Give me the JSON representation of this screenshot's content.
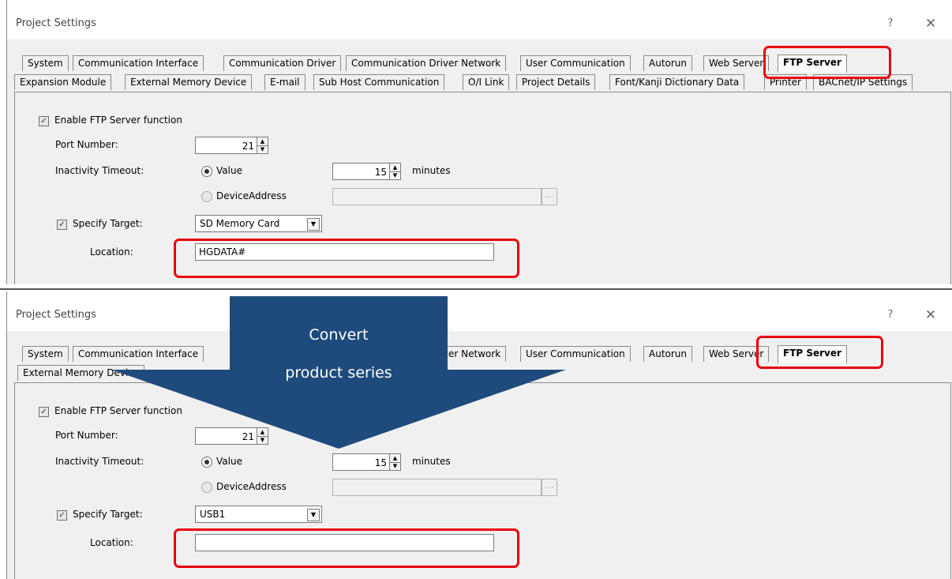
{
  "dialog_title": "Project Settings",
  "help_glyph": "?",
  "close_glyph": "✕",
  "top": {
    "tabs_row1": [
      "System",
      "Communication Interface",
      "Communication Driver",
      "Communication Driver Network",
      "User Communication",
      "Autorun",
      "Web Server",
      "FTP Server"
    ],
    "tabs_row2": [
      "Expansion Module",
      "External Memory Device",
      "E-mail",
      "Sub Host Communication",
      "O/I Link",
      "Project Details",
      "Font/Kanji Dictionary Data",
      "Printer",
      "BACnet/IP Settings"
    ],
    "active_tab": "FTP Server",
    "enable_label": "Enable FTP Server function",
    "port_label": "Port Number:",
    "port_value": "21",
    "timeout_label": "Inactivity Timeout:",
    "value_radio_label": "Value",
    "timeout_value": "15",
    "minutes_label": "minutes",
    "device_address_label": "DeviceAddress",
    "specify_target_label": "Specify Target:",
    "target_value": "SD Memory Card",
    "location_label": "Location:",
    "location_value": "HGDATA#"
  },
  "bottom": {
    "tabs_row1": [
      "System",
      "Communication Interface",
      "Communication Driver Network",
      "User Communication",
      "Autorun",
      "Web Server",
      "FTP Server"
    ],
    "tabs_row2": [
      "External Memory Device"
    ],
    "active_tab": "FTP Server",
    "enable_label": "Enable FTP Server function",
    "port_label": "Port Number:",
    "port_value": "21",
    "timeout_label": "Inactivity Timeout:",
    "value_radio_label": "Value",
    "timeout_value": "15",
    "minutes_label": "minutes",
    "device_address_label": "DeviceAddress",
    "specify_target_label": "Specify Target:",
    "target_value": "USB1",
    "location_label": "Location:",
    "location_value": ""
  },
  "overlay": {
    "line1": "Convert",
    "line2": "product series",
    "arrow_color": "#1f4a7c",
    "highlight_color": "#e8000b"
  }
}
